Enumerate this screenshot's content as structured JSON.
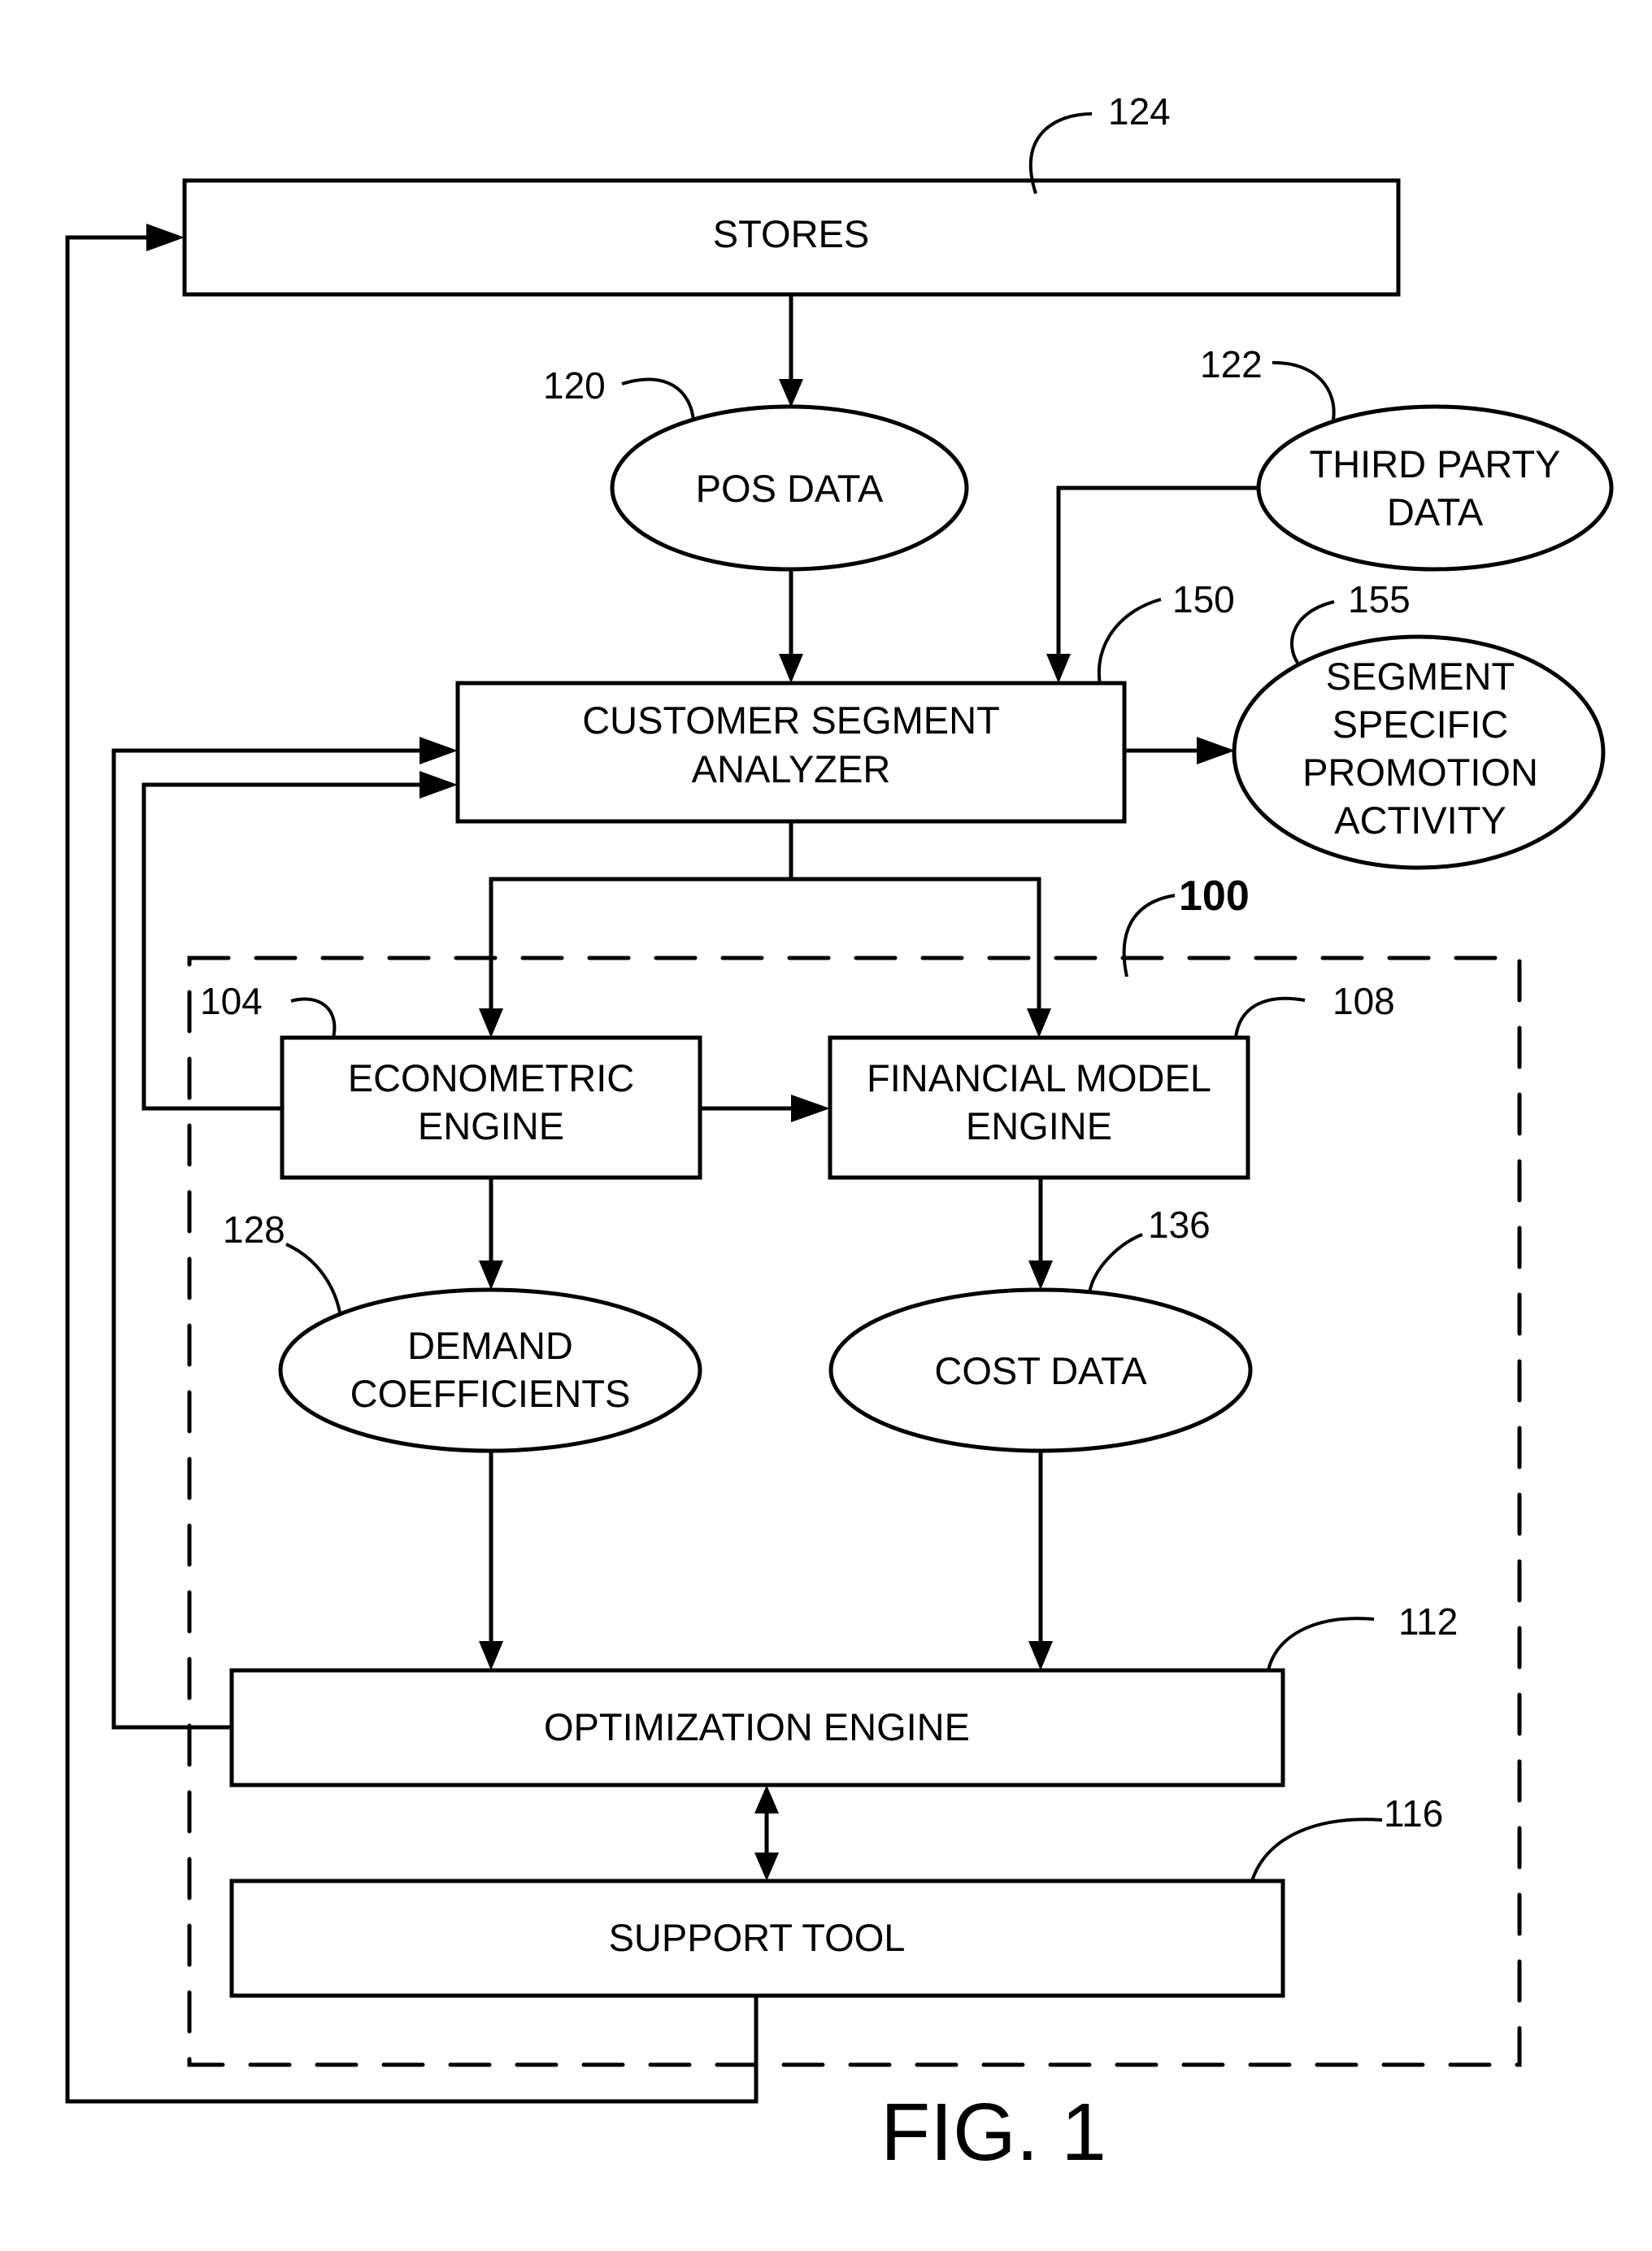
{
  "figure": {
    "caption": "FIG. 1",
    "system_ref": "100"
  },
  "nodes": {
    "stores": {
      "label": "STORES",
      "ref": "124"
    },
    "pos_data": {
      "label": "POS DATA",
      "ref": "120"
    },
    "third_party_data": {
      "lines": [
        "THIRD PARTY",
        "DATA"
      ],
      "ref": "122"
    },
    "customer_segment_analyzer": {
      "lines": [
        "CUSTOMER SEGMENT",
        "ANALYZER"
      ],
      "ref": "150"
    },
    "segment_specific_promotion_activity": {
      "lines": [
        "SEGMENT",
        "SPECIFIC",
        "PROMOTION",
        "ACTIVITY"
      ],
      "ref": "155"
    },
    "econometric_engine": {
      "lines": [
        "ECONOMETRIC",
        "ENGINE"
      ],
      "ref": "104"
    },
    "financial_model_engine": {
      "lines": [
        "FINANCIAL MODEL",
        "ENGINE"
      ],
      "ref": "108"
    },
    "demand_coefficients": {
      "lines": [
        "DEMAND",
        "COEFFICIENTS"
      ],
      "ref": "128"
    },
    "cost_data": {
      "label": "COST DATA",
      "ref": "136"
    },
    "optimization_engine": {
      "label": "OPTIMIZATION ENGINE",
      "ref": "112"
    },
    "support_tool": {
      "label": "SUPPORT TOOL",
      "ref": "116"
    }
  },
  "edges": [
    {
      "from": "stores",
      "to": "pos_data"
    },
    {
      "from": "pos_data",
      "to": "customer_segment_analyzer"
    },
    {
      "from": "third_party_data",
      "to": "customer_segment_analyzer"
    },
    {
      "from": "customer_segment_analyzer",
      "to": "segment_specific_promotion_activity"
    },
    {
      "from": "customer_segment_analyzer",
      "to": "econometric_engine"
    },
    {
      "from": "customer_segment_analyzer",
      "to": "financial_model_engine"
    },
    {
      "from": "econometric_engine",
      "to": "financial_model_engine"
    },
    {
      "from": "econometric_engine",
      "to": "customer_segment_analyzer"
    },
    {
      "from": "optimization_engine",
      "to": "customer_segment_analyzer"
    },
    {
      "from": "econometric_engine",
      "to": "demand_coefficients"
    },
    {
      "from": "financial_model_engine",
      "to": "cost_data"
    },
    {
      "from": "demand_coefficients",
      "to": "optimization_engine"
    },
    {
      "from": "cost_data",
      "to": "optimization_engine"
    },
    {
      "from": "optimization_engine",
      "to": "support_tool",
      "bidirectional": true
    },
    {
      "from": "support_tool",
      "to": "stores"
    }
  ]
}
